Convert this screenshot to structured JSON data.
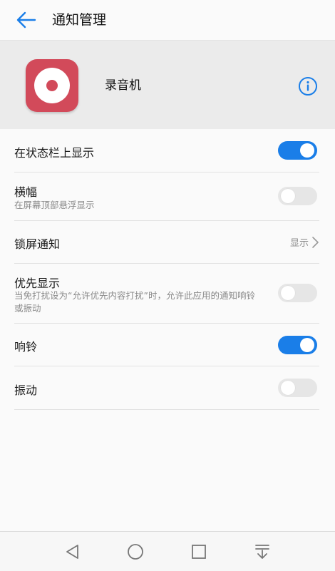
{
  "header": {
    "title": "通知管理"
  },
  "app": {
    "name": "录音机"
  },
  "settings": [
    {
      "label": "在状态栏上显示",
      "enabled": true
    },
    {
      "label": "横幅",
      "sublabel": "在屏幕顶部悬浮显示",
      "enabled": false
    },
    {
      "label": "锁屏通知",
      "value": "显示"
    },
    {
      "label": "优先显示",
      "sublabel": "当免打扰设为“允许优先内容打扰”时，允许此应用的通知响铃或振动",
      "enabled": false
    },
    {
      "label": "响铃",
      "enabled": true
    },
    {
      "label": "振动",
      "enabled": false
    }
  ],
  "colors": {
    "accent": "#1a7ee8",
    "app_icon": "#d24a5a",
    "toggle_off": "#e6e6e6"
  },
  "icons": {
    "back": "back-arrow-icon",
    "info": "info-icon",
    "chevron": "chevron-right-icon",
    "nav": [
      "back-triangle-icon",
      "home-circle-icon",
      "recents-square-icon",
      "notification-pulldown-icon"
    ]
  }
}
